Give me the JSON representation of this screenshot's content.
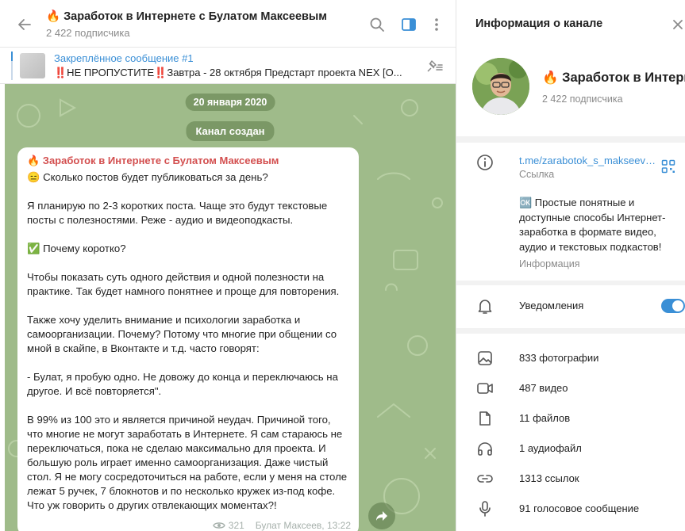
{
  "chat": {
    "title": "🔥 Заработок в Интернете с Булатом Максеевым",
    "subtitle": "2 422 подписчика",
    "pinned": {
      "title": "Закреплённое сообщение #1",
      "text": "‼️НЕ ПРОПУСТИТЕ‼️Завтра - 28 октября Предстарт проекта NEX [О..."
    },
    "date": "20 января 2020",
    "service": "Канал создан",
    "message": {
      "author": "🔥 Заработок в Интернете с Булатом Максеевым",
      "paragraphs": [
        "😑 Сколько постов будет публиковаться за день?",
        "Я планирую по 2-3 коротких поста. Чаще это будут текстовые посты с полезностями. Реже - аудио и видеоподкасты.",
        "✅ Почему коротко?",
        "Чтобы показать суть одного действия и одной полезности на практике. Так будет намного понятнее и проще для повторения.",
        "Также хочу уделить внимание и психологии заработка и самоорганизации. Почему? Потому что многие при общении со мной в скайпе, в Вконтакте и т.д. часто говорят:",
        "- Булат, я пробую одно. Не довожу до конца и переключаюсь на другое. И всё повторяется\".",
        "В 99% из 100 это и является причиной неудач. Причиной того, что многие не могут заработать в Интернете. Я сам стараюсь не переключаться, пока не сделаю максимально для проекта. И большую роль играет именно самоорганизация. Даже чистый стол. Я не могу сосредоточиться на работе, если у меня на столе лежат 5 ручек, 7 блокнотов и по несколько кружек из-под кофе. Что уж говорить о других отвлекающих моментах?!"
      ],
      "views": "321",
      "signature": "Булат Максеев, 13:22"
    }
  },
  "info": {
    "header": "Информация о канале",
    "name": "🔥 Заработок в Интернете с Булатом Максеевым",
    "subscribers": "2 422 подписчика",
    "link": "t.me/zarabotok_s_makseevym",
    "link_label": "Ссылка",
    "description": "🆗 Простые понятные и доступные способы Интернет-заработка в формате видео, аудио и текстовых подкастов!",
    "description_label": "Информация",
    "notifications_label": "Уведомления",
    "notifications_on": true,
    "media": [
      {
        "icon": "photo-icon",
        "label": "833 фотографии"
      },
      {
        "icon": "video-icon",
        "label": "487 видео"
      },
      {
        "icon": "file-icon",
        "label": "11 файлов"
      },
      {
        "icon": "headphones-icon",
        "label": "1 аудиофайл"
      },
      {
        "icon": "link-icon",
        "label": "1313 ссылок"
      },
      {
        "icon": "microphone-icon",
        "label": "91 голосовое сообщение"
      }
    ],
    "colors": {
      "accent": "#3a8fd6",
      "author": "#d34f4f",
      "wallpaper": "#9fbb8a"
    }
  }
}
